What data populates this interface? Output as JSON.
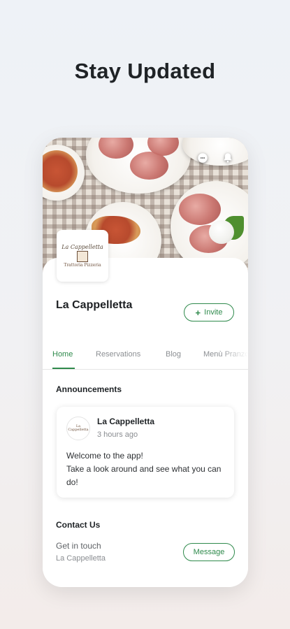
{
  "headline": "Stay Updated",
  "colors": {
    "accent": "#2f8a4c",
    "text": "#1f2326",
    "muted": "#8a8d91"
  },
  "hero": {
    "icons": [
      "chat-icon",
      "bell-icon"
    ]
  },
  "venue": {
    "name": "La Cappelletta",
    "invite_label": "Invite",
    "logo_script": "La Cappelletta",
    "logo_tag": "Trattoria Pizzeria"
  },
  "tabs": [
    {
      "label": "Home",
      "active": true
    },
    {
      "label": "Reservations",
      "active": false
    },
    {
      "label": "Blog",
      "active": false
    },
    {
      "label": "Menù Pranzo",
      "active": false
    }
  ],
  "announcements": {
    "title": "Announcements",
    "post": {
      "author": "La Cappelletta",
      "time": "3 hours ago",
      "body_line1": "Welcome to the app!",
      "body_line2": "Take a look around and see what you can do!"
    }
  },
  "contact": {
    "title": "Contact Us",
    "subtitle": "Get in touch",
    "name": "La Cappelletta",
    "message_label": "Message"
  }
}
